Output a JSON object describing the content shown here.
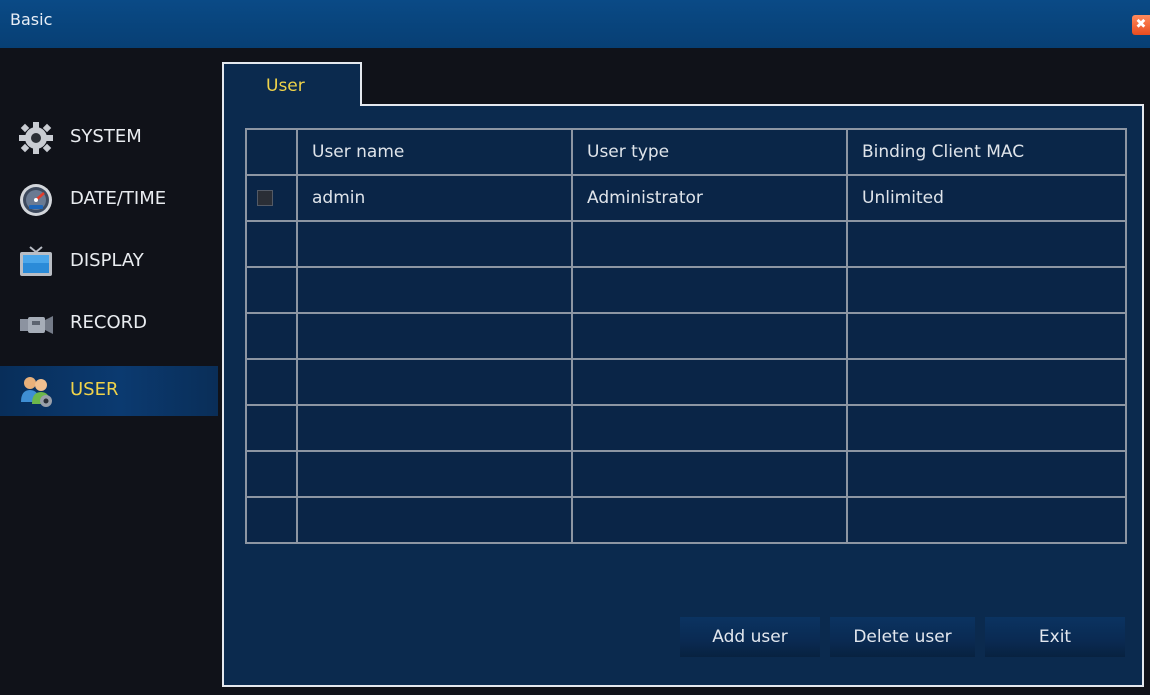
{
  "window": {
    "title": "Basic",
    "close_glyph": "✖"
  },
  "sidebar": {
    "items": [
      {
        "label": "SYSTEM",
        "icon": "gear-icon"
      },
      {
        "label": "DATE/TIME",
        "icon": "clock-icon"
      },
      {
        "label": "DISPLAY",
        "icon": "tv-icon"
      },
      {
        "label": "RECORD",
        "icon": "camera-icon"
      },
      {
        "label": "USER",
        "icon": "users-icon",
        "active": true
      }
    ]
  },
  "tabs": [
    {
      "label": "User",
      "active": true
    }
  ],
  "table": {
    "columns": [
      "",
      "User name",
      "User type",
      "Binding Client MAC"
    ],
    "rows": [
      {
        "name": "admin",
        "type": "Administrator",
        "mac": "Unlimited",
        "checked": false
      },
      {
        "name": "",
        "type": "",
        "mac": ""
      },
      {
        "name": "",
        "type": "",
        "mac": ""
      },
      {
        "name": "",
        "type": "",
        "mac": ""
      },
      {
        "name": "",
        "type": "",
        "mac": ""
      },
      {
        "name": "",
        "type": "",
        "mac": ""
      },
      {
        "name": "",
        "type": "",
        "mac": ""
      },
      {
        "name": "",
        "type": "",
        "mac": ""
      }
    ]
  },
  "buttons": {
    "add": "Add user",
    "delete": "Delete user",
    "exit": "Exit"
  },
  "colors": {
    "titlebar": "#0a4a86",
    "panel": "#0b2a4e",
    "active_text": "#f0d34a",
    "close": "#e84c1f"
  }
}
